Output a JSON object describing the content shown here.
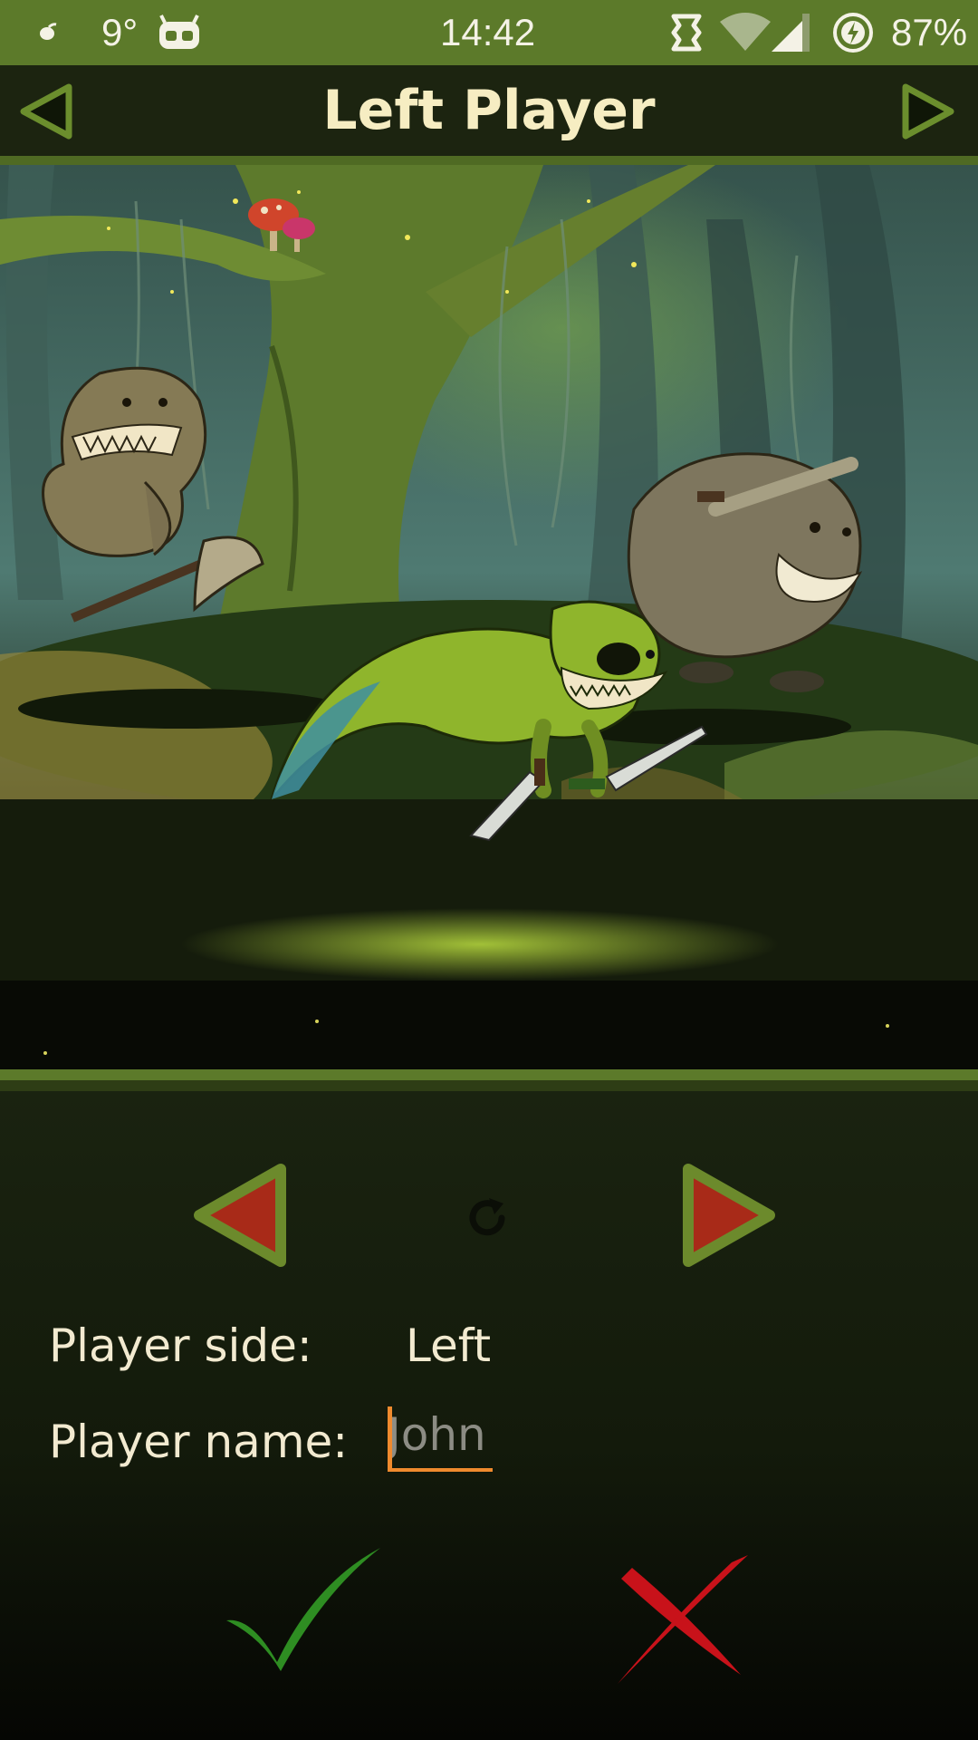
{
  "status_bar": {
    "temperature": "9°",
    "time": "14:42",
    "battery_percent": "87%",
    "icons": [
      "notification-leaf-icon",
      "android-robot-icon",
      "sync-icon",
      "wifi-icon",
      "signal-icon",
      "battery-charging-icon"
    ]
  },
  "header": {
    "title": "Left Player",
    "prev_icon": "triangle-left-icon",
    "next_icon": "triangle-right-icon"
  },
  "scene": {
    "description_icon": "forest-battle-artwork"
  },
  "character_controls": {
    "prev_icon": "red-triangle-left-icon",
    "reset_icon": "refresh-icon",
    "next_icon": "red-triangle-right-icon"
  },
  "form": {
    "side_label": "Player side:",
    "side_value": "Left",
    "name_label": "Player name:",
    "name_value": "",
    "name_placeholder": "John"
  },
  "actions": {
    "confirm_icon": "green-check-icon",
    "cancel_icon": "red-cross-icon"
  },
  "colors": {
    "accent_green": "#5c7a2a",
    "header_bg": "#1c2410",
    "title_text": "#f6edc2",
    "input_underline": "#ef8a2e",
    "control_red": "#a82a18"
  }
}
